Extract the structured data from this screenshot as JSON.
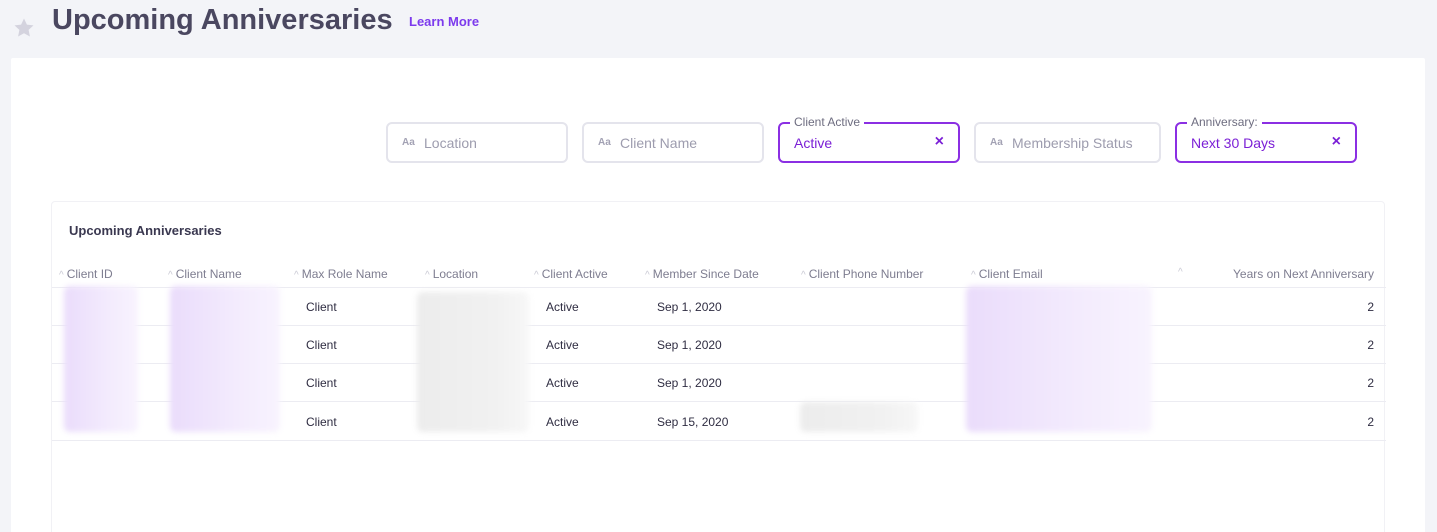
{
  "header": {
    "title": "Upcoming Anniversaries",
    "learn_more": "Learn More"
  },
  "filters": {
    "location": {
      "icon": "Aa",
      "placeholder": "Location"
    },
    "client_name": {
      "icon": "Aa",
      "placeholder": "Client Name"
    },
    "client_active": {
      "legend": "Client Active",
      "value": "Active",
      "clear": "×"
    },
    "membership_status": {
      "icon": "Aa",
      "placeholder": "Membership Status"
    },
    "anniversary": {
      "legend": "Anniversary:",
      "value": "Next 30 Days",
      "clear": "×"
    }
  },
  "table": {
    "title": "Upcoming Anniversaries",
    "columns": [
      "Client ID",
      "Client Name",
      "Max Role Name",
      "Location",
      "Client Active",
      "Member Since Date",
      "Client Phone Number",
      "Client Email",
      "Years on Next Anniversary"
    ],
    "rows": [
      {
        "role": "Client",
        "active": "Active",
        "since": "Sep 1, 2020",
        "years": "2"
      },
      {
        "role": "Client",
        "active": "Active",
        "since": "Sep 1, 2020",
        "years": "2"
      },
      {
        "role": "Client",
        "active": "Active",
        "since": "Sep 1, 2020",
        "years": "2"
      },
      {
        "role": "Client",
        "active": "Active",
        "since": "Sep 15, 2020",
        "years": "2"
      }
    ]
  },
  "colors": {
    "accent": "#8b2fe3",
    "accent_text": "#7b1fd6",
    "link": "#7c3aed"
  },
  "icons": {
    "favorite": "star-icon",
    "sort": "sort-caret-icon",
    "text_filter": "text-filter-icon",
    "clear": "close-icon"
  }
}
